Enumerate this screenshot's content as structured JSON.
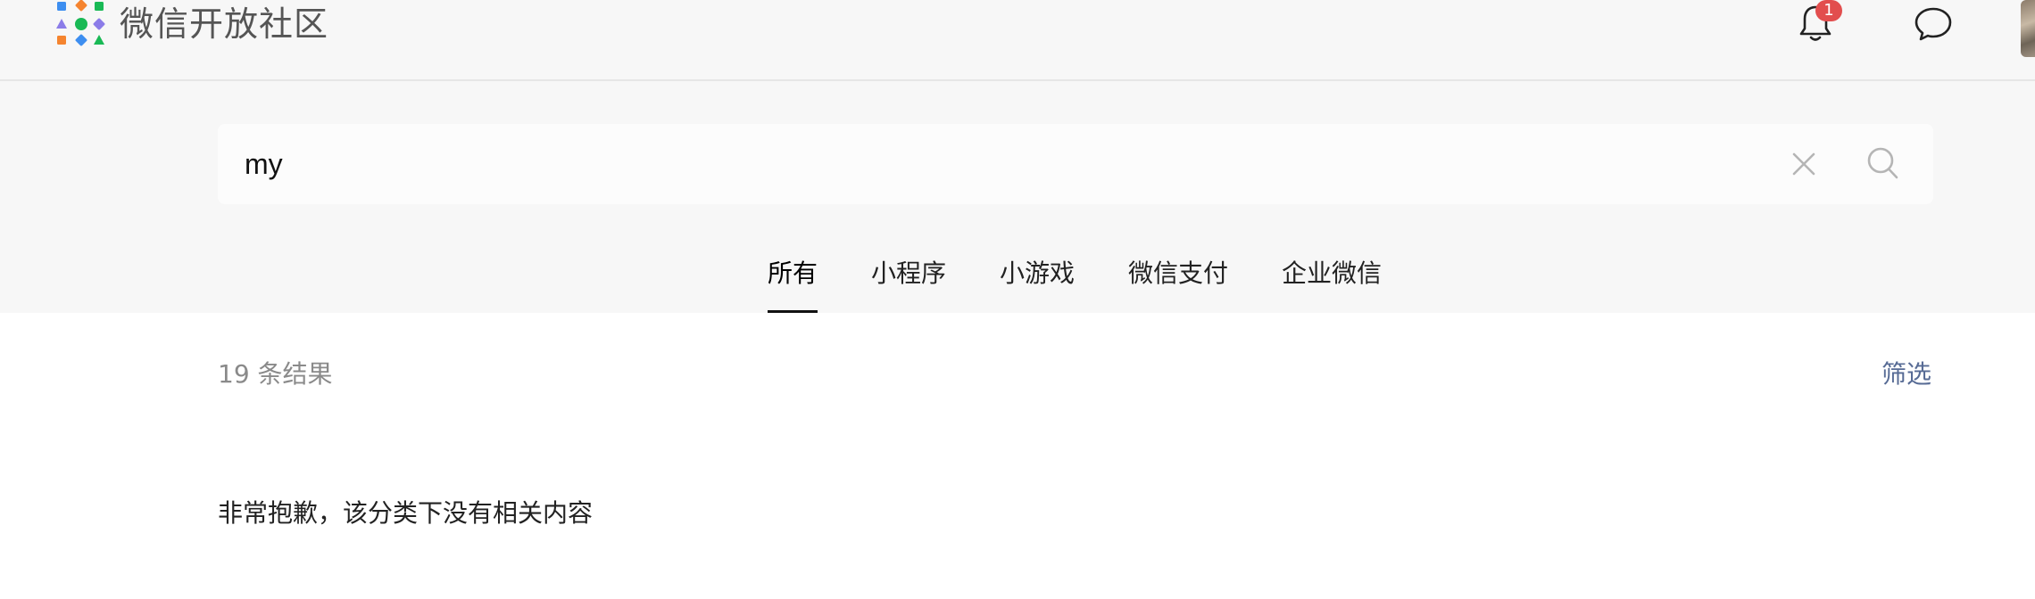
{
  "header": {
    "brand": "微信开放社区",
    "notification_count": "1"
  },
  "search": {
    "query": "my"
  },
  "tabs": [
    {
      "label": "所有",
      "active": true
    },
    {
      "label": "小程序",
      "active": false
    },
    {
      "label": "小游戏",
      "active": false
    },
    {
      "label": "微信支付",
      "active": false
    },
    {
      "label": "企业微信",
      "active": false
    }
  ],
  "results": {
    "count_text": "19 条结果",
    "filter_label": "筛选",
    "empty_message": "非常抱歉，该分类下没有相关内容"
  },
  "icons": {
    "logo": "wechat-open-community-logo",
    "notification": "bell-icon",
    "messages": "chat-bubble-icon",
    "clear": "close-icon",
    "search": "search-icon"
  },
  "colors": {
    "badge": "#e24e4e",
    "link": "#576b95",
    "band_background": "#f7f7f7"
  }
}
